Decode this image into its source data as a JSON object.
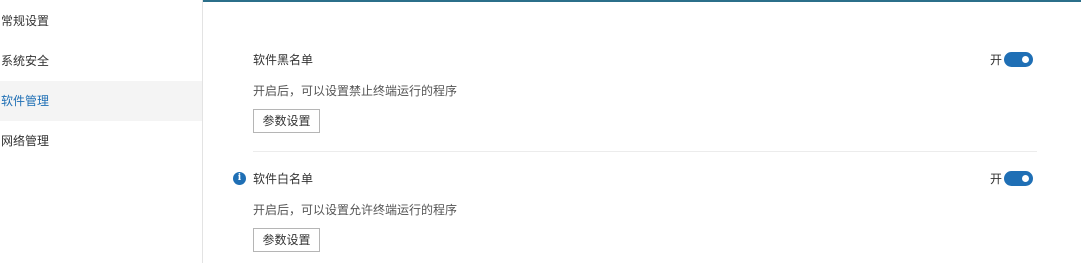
{
  "sidebar": {
    "items": [
      {
        "label": "常规设置",
        "active": false
      },
      {
        "label": "系统安全",
        "active": false
      },
      {
        "label": "软件管理",
        "active": true
      },
      {
        "label": "网络管理",
        "active": false
      }
    ]
  },
  "sections": [
    {
      "title": "软件黑名单",
      "description": "开启后，可以设置禁止终端运行的程序",
      "button_label": "参数设置",
      "toggle_label": "开",
      "enabled": true
    },
    {
      "title": "软件白名单",
      "description": "开启后，可以设置允许终端运行的程序",
      "button_label": "参数设置",
      "toggle_label": "开",
      "enabled": true,
      "info_icon": "info-icon"
    }
  ],
  "colors": {
    "accent": "#1f6fb5",
    "active_nav_bg": "#f4f4f4",
    "top_border": "#2b6f8a"
  }
}
